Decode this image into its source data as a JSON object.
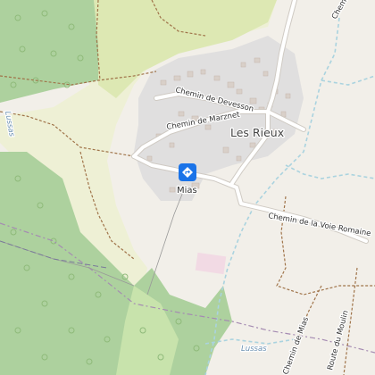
{
  "map": {
    "place_name": "Les Rieux",
    "roads": {
      "chemin_devesson": "Chemin de Devesson",
      "chemin_marznet": "Chemin de Marznet",
      "chemin_voie_romaine": "Chemin de la Voie Romaine",
      "route_moulin": "Route du Moulin",
      "chemin_mias": "Chemin de Mias",
      "chemin_top": "Chemin"
    },
    "waterways": {
      "lussas_left": "Lussas",
      "lussas_bottom": "Lussas"
    },
    "poi": {
      "label": "Mias",
      "icon": "directions-sign-icon",
      "color": "#1a73e8"
    },
    "colors": {
      "forest": "#add19e",
      "meadow": "#cde5a8",
      "farmland": "#eef0d5",
      "residential": "#e0dfdf",
      "building": "#d9d0c9",
      "road": "#ffffff",
      "stream": "#aad3df",
      "track": "#a0744a",
      "admin_boundary": "#a58bb2",
      "pink_area": "#f2dae4"
    }
  }
}
